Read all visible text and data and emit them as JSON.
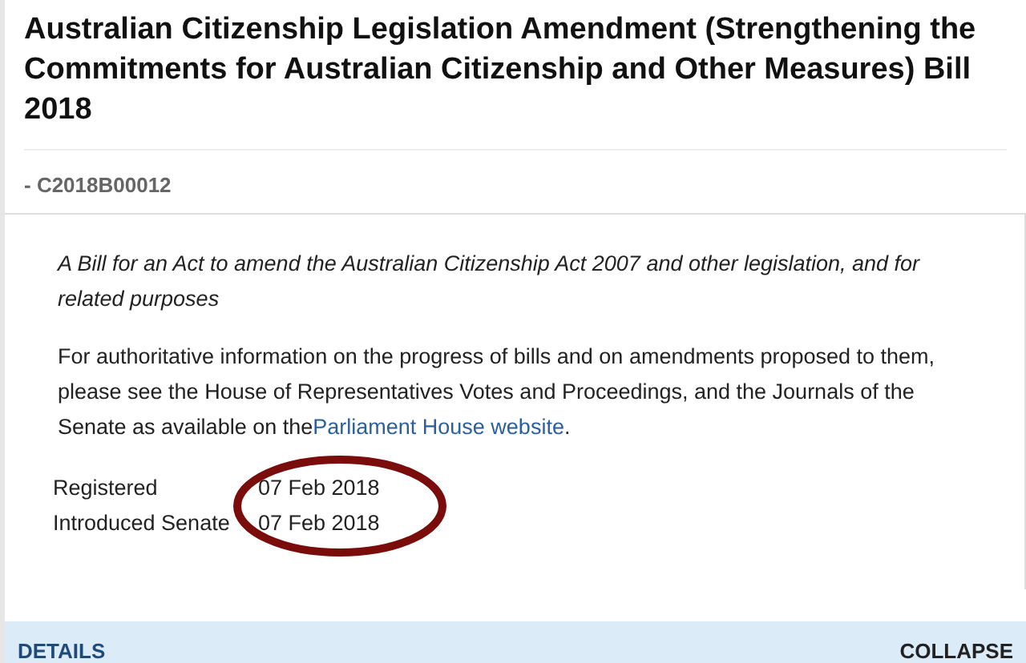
{
  "title": "Australian Citizenship Legislation Amendment (Strengthening the Commitments for Australian Citizenship and Other Measures) Bill 2018",
  "code": "- C2018B00012",
  "summary": {
    "description": "A Bill for an Act to amend the Australian Citizenship Act 2007 and other legislation, and for related purposes",
    "note": "For authoritative information on the progress of bills and on amendments proposed to them, please see the House of Representatives Votes and Proceedings, and the Journals of the Senate as available on the",
    "link": "Parliament House website",
    "note_end": ".",
    "dates": [
      {
        "label": "Registered",
        "value": "07 Feb 2018"
      },
      {
        "label": "Introduced Senate",
        "value": "07 Feb 2018"
      }
    ]
  },
  "details_bar": {
    "label": "DETAILS",
    "action": "COLLAPSE"
  }
}
